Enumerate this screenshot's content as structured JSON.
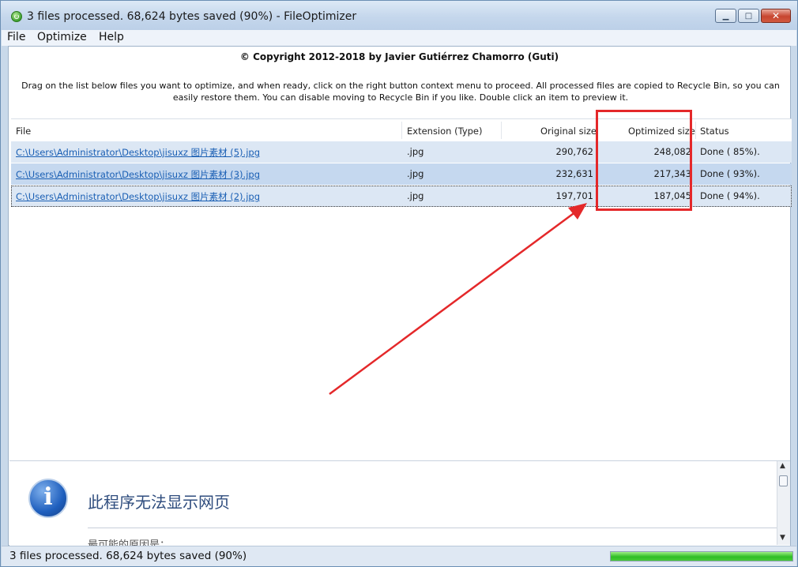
{
  "window": {
    "title": "3 files processed. 68,624 bytes saved (90%) - FileOptimizer"
  },
  "menu": [
    "File",
    "Optimize",
    "Help"
  ],
  "header": {
    "copyright": "© Copyright 2012-2018 by Javier Gutiérrez Chamorro (Guti)",
    "instructions": "Drag on the list below files you want to optimize, and when ready, click on the right button context menu to proceed. All processed files are copied to Recycle Bin, so you can easily restore them. You can disable moving to Recycle Bin if you like. Double click an item to preview it."
  },
  "list": {
    "columns": [
      "File",
      "Extension (Type)",
      "Original size",
      "Optimized size",
      "Status"
    ],
    "rows": [
      {
        "file": "C:\\Users\\Administrator\\Desktop\\jisuxz 图片素材 (5).jpg",
        "ext": ".jpg",
        "original": "290,762",
        "optimized": "248,082",
        "status": "Done ( 85%)."
      },
      {
        "file": "C:\\Users\\Administrator\\Desktop\\jisuxz 图片素材 (3).jpg",
        "ext": ".jpg",
        "original": "232,631",
        "optimized": "217,343",
        "status": "Done ( 93%)."
      },
      {
        "file": "C:\\Users\\Administrator\\Desktop\\jisuxz 图片素材 (2).jpg",
        "ext": ".jpg",
        "original": "197,701",
        "optimized": "187,045",
        "status": "Done ( 94%)."
      }
    ]
  },
  "preview": {
    "title": "此程序无法显示网页",
    "subtitle": "最可能的原因是："
  },
  "statusbar": {
    "text": "3 files processed. 68,624 bytes saved (90%)",
    "progress": 1.0
  },
  "colors": {
    "annotation": "#e4282a",
    "link": "#1a5fb4",
    "progress": "#2fbd25"
  }
}
